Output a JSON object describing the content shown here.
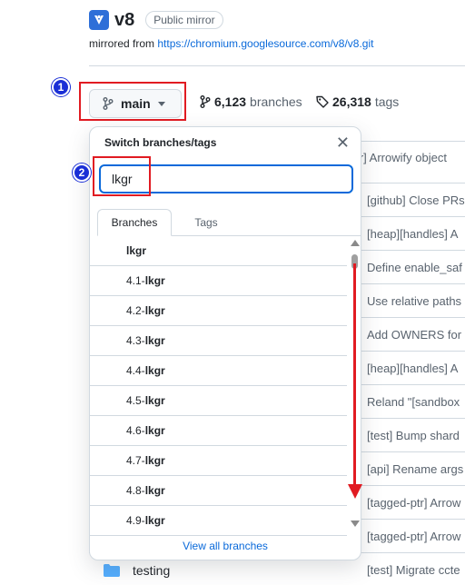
{
  "repo": {
    "name": "v8",
    "badge": "Public mirror",
    "mirrored_prefix": "mirrored from",
    "mirrored_url": "https://chromium.googlesource.com/v8/v8.git"
  },
  "toolbar": {
    "branch_label": "main",
    "branches_count": "6,123",
    "branches_label": "branches",
    "tags_count": "26,318",
    "tags_label": "tags"
  },
  "annotations": {
    "step1": "1",
    "step2": "2",
    "accent": "#e11b22",
    "badge_color": "#1a2fd6"
  },
  "background_commits": [
    "ptr] Arrowify object",
    "[github] Close PRs",
    "[heap][handles] A",
    "Define enable_saf",
    "Use relative paths",
    "Add OWNERS for",
    "[heap][handles] A",
    "Reland \"[sandbox",
    "[test] Bump shard",
    "[api] Rename args",
    "[tagged-ptr] Arrow",
    "[tagged-ptr] Arrow",
    "[test] Migrate ccte"
  ],
  "folder_row": {
    "name": "testing"
  },
  "dropdown": {
    "title": "Switch branches/tags",
    "filter_value": "lkgr",
    "tabs": [
      "Branches",
      "Tags"
    ],
    "items": [
      {
        "prefix": "",
        "match": "lkgr"
      },
      {
        "prefix": "4.1-",
        "match": "lkgr"
      },
      {
        "prefix": "4.2-",
        "match": "lkgr"
      },
      {
        "prefix": "4.3-",
        "match": "lkgr"
      },
      {
        "prefix": "4.4-",
        "match": "lkgr"
      },
      {
        "prefix": "4.5-",
        "match": "lkgr"
      },
      {
        "prefix": "4.6-",
        "match": "lkgr"
      },
      {
        "prefix": "4.7-",
        "match": "lkgr"
      },
      {
        "prefix": "4.8-",
        "match": "lkgr"
      },
      {
        "prefix": "4.9-",
        "match": "lkgr"
      }
    ],
    "view_all": "View all branches"
  }
}
